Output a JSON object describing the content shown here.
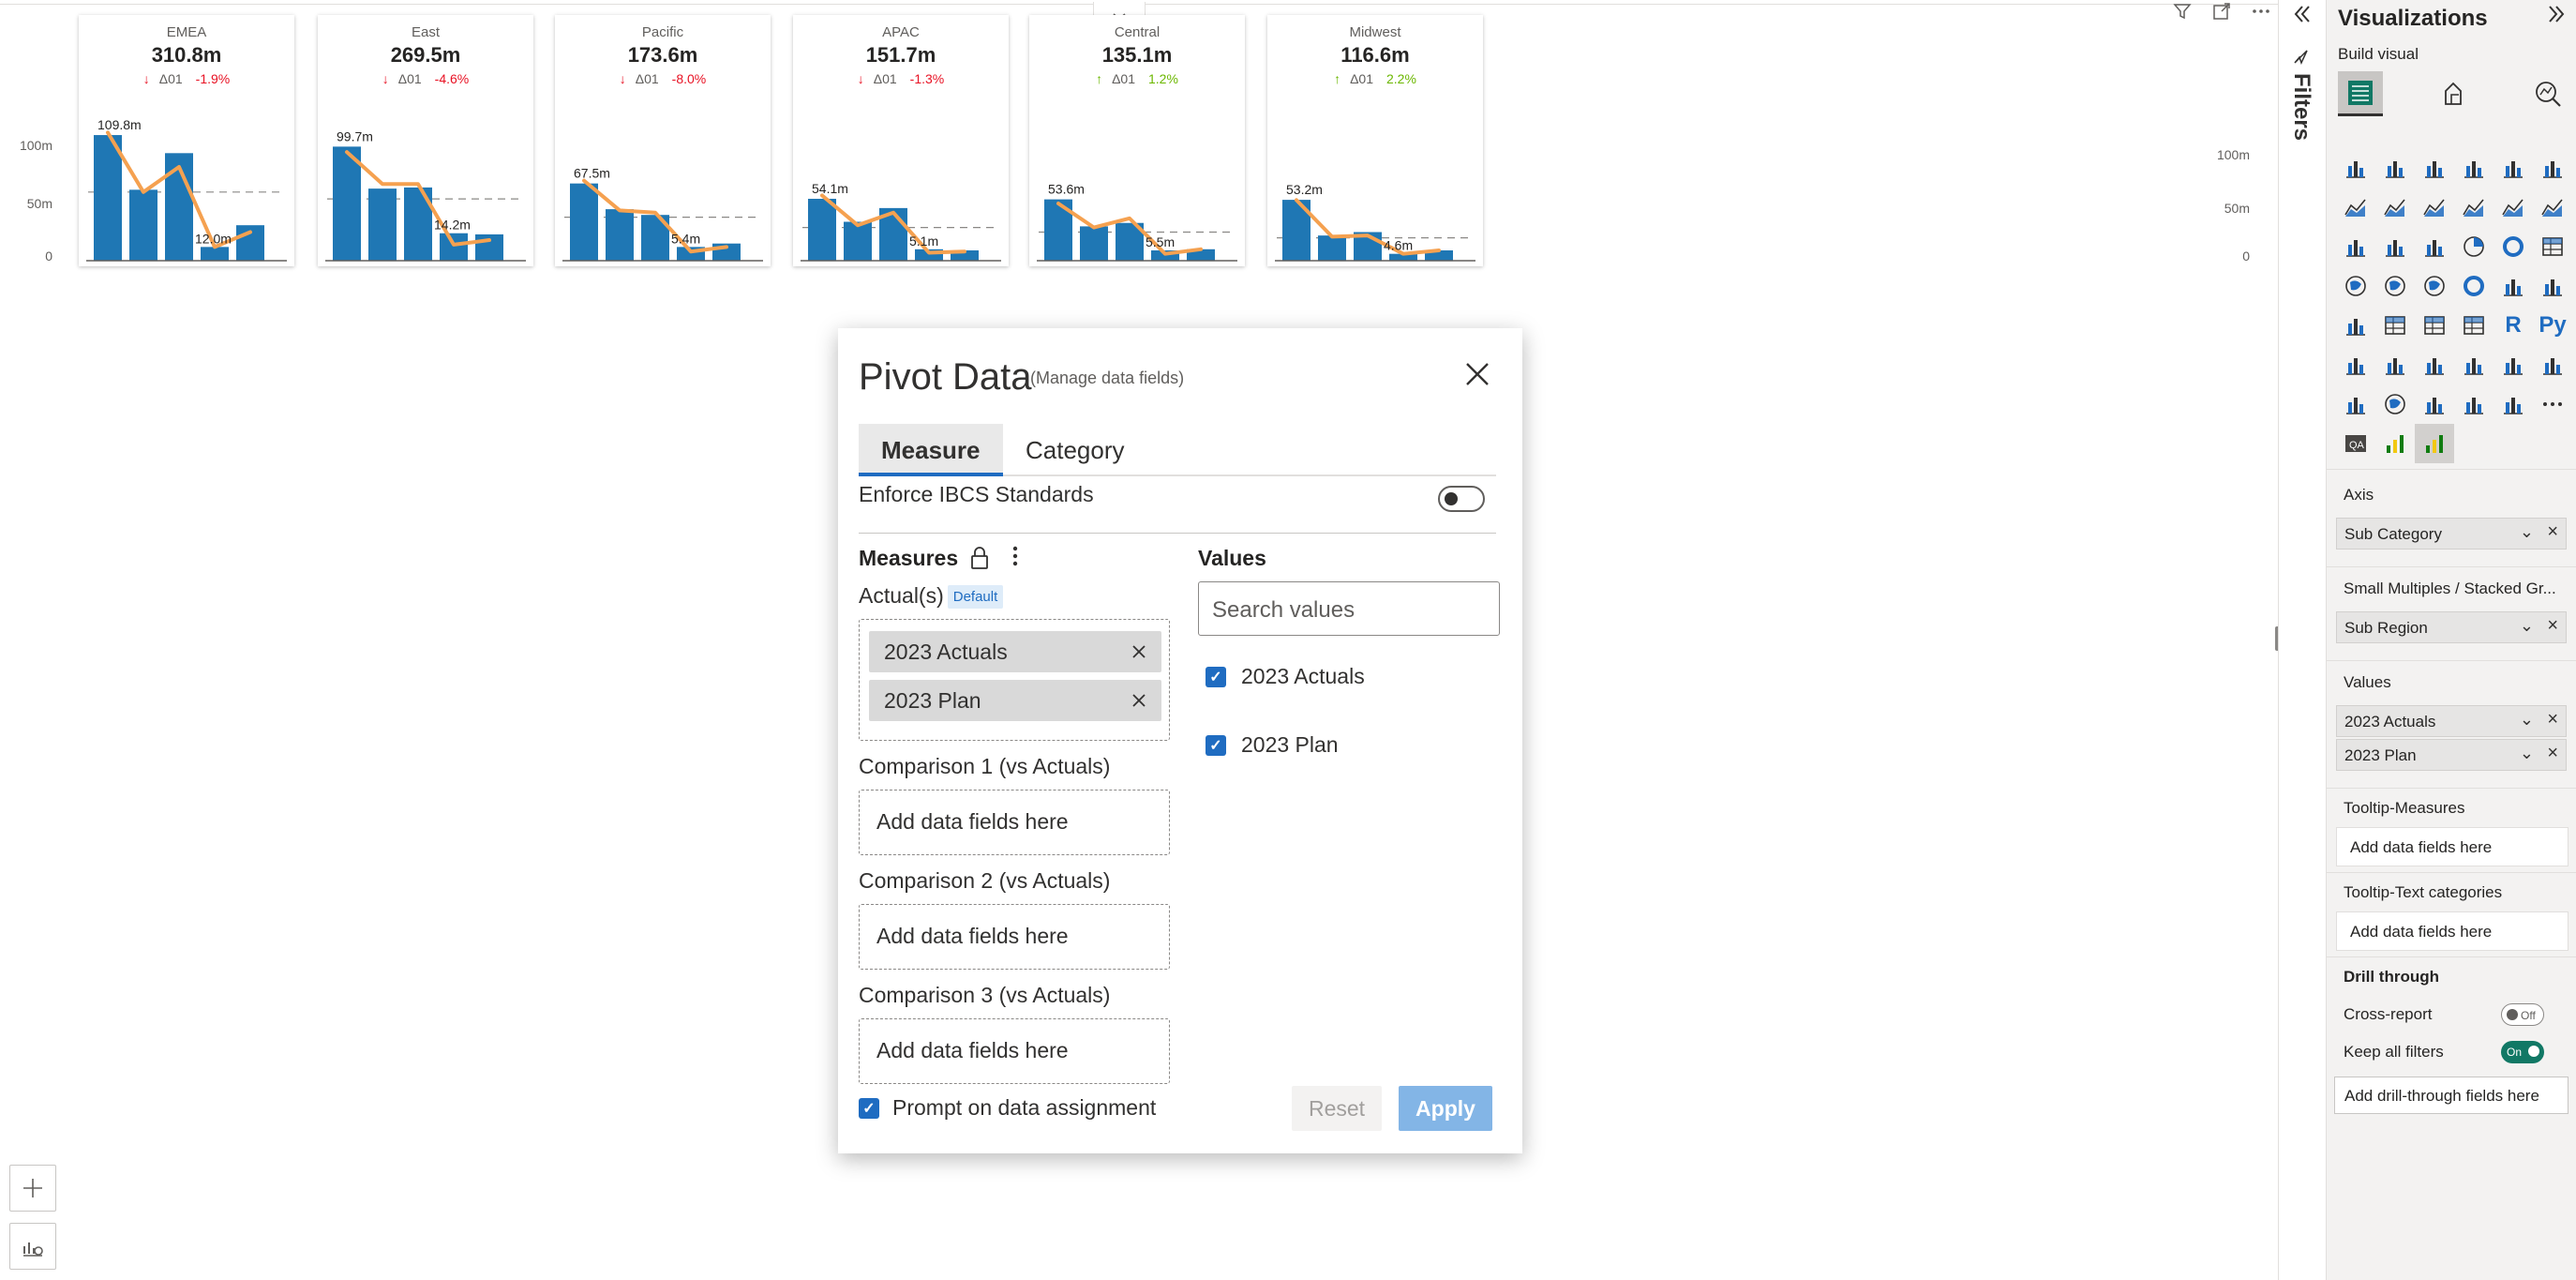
{
  "canvas": {
    "y_axis_left": [
      "100m",
      "50m",
      "0"
    ],
    "y_axis_right": [
      "100m",
      "50m",
      "0"
    ],
    "header_icons": [
      "filter-icon",
      "focus-mode-icon",
      "more-options-icon"
    ],
    "collapse_icon": "double-chevron-down-icon"
  },
  "cards": [
    {
      "region": "EMEA",
      "total": "310.8m",
      "direction": "down",
      "delta_label": "Δ01",
      "pct": "-1.9%",
      "bars": [
        109.8,
        62,
        94,
        12,
        31
      ],
      "line": [
        112,
        60,
        82,
        12,
        25
      ],
      "plan_ref": 60,
      "labels": [
        "109.8m",
        "12.0m"
      ]
    },
    {
      "region": "East",
      "total": "269.5m",
      "direction": "down",
      "delta_label": "Δ01",
      "pct": "-4.6%",
      "bars": [
        99.7,
        63,
        64,
        24,
        23
      ],
      "line": [
        95,
        67,
        67,
        14,
        18
      ],
      "plan_ref": 54,
      "labels": [
        "99.7m",
        "14.2m"
      ]
    },
    {
      "region": "Pacific",
      "total": "173.6m",
      "direction": "down",
      "delta_label": "Δ01",
      "pct": "-8.0%",
      "bars": [
        67.5,
        45,
        40,
        12,
        15
      ],
      "line": [
        70,
        44,
        42,
        8,
        12
      ],
      "plan_ref": 38,
      "labels": [
        "67.5m",
        "5.4m"
      ]
    },
    {
      "region": "APAC",
      "total": "151.7m",
      "direction": "down",
      "delta_label": "Δ01",
      "pct": "-1.3%",
      "bars": [
        54.1,
        34,
        46,
        10,
        9
      ],
      "line": [
        57,
        31,
        42,
        7,
        8
      ],
      "plan_ref": 29,
      "labels": [
        "54.1m",
        "5.1m"
      ]
    },
    {
      "region": "Central",
      "total": "135.1m",
      "direction": "up",
      "delta_label": "Δ01",
      "pct": "1.2%",
      "bars": [
        53.6,
        30,
        33,
        9,
        10
      ],
      "line": [
        50,
        29,
        37,
        6,
        10
      ],
      "plan_ref": 25,
      "labels": [
        "53.6m",
        "5.5m"
      ]
    },
    {
      "region": "Midwest",
      "total": "116.6m",
      "direction": "up",
      "delta_label": "Δ01",
      "pct": "2.2%",
      "bars": [
        53.2,
        22,
        25,
        6,
        9
      ],
      "line": [
        53,
        21,
        22,
        6,
        9
      ],
      "plan_ref": 20,
      "labels": [
        "53.2m",
        "4.6m"
      ]
    }
  ],
  "dialog": {
    "title": "Pivot Data",
    "subtitle": "(Manage data fields)",
    "close_icon": "close-icon",
    "tabs": [
      "Measure",
      "Category"
    ],
    "active_tab": "Measure",
    "ibcs_label": "Enforce IBCS Standards",
    "ibcs_enabled": false,
    "measures_title": "Measures",
    "actuals_label": "Actual(s)",
    "default_badge": "Default",
    "actual_chips": [
      "2023 Actuals",
      "2023 Plan"
    ],
    "comparisons": [
      {
        "label": "Comparison 1 (vs Actuals)",
        "placeholder": "Add data fields here"
      },
      {
        "label": "Comparison 2 (vs Actuals)",
        "placeholder": "Add data fields here"
      },
      {
        "label": "Comparison 3 (vs Actuals)",
        "placeholder": "Add data fields here"
      }
    ],
    "values_title": "Values",
    "search_placeholder": "Search values",
    "values": [
      {
        "label": "2023 Actuals",
        "checked": true
      },
      {
        "label": "2023 Plan",
        "checked": true
      }
    ],
    "prompt_label": "Prompt on data assignment",
    "prompt_checked": true,
    "reset_label": "Reset",
    "apply_label": "Apply"
  },
  "filters": {
    "label": "Filters"
  },
  "viz": {
    "title": "Visualizations",
    "build_label": "Build visual",
    "axis_label": "Axis",
    "axis_field": "Sub Category",
    "small_multiples_label": "Small Multiples / Stacked Gr...",
    "small_multiples_field": "Sub Region",
    "values_label": "Values",
    "values_fields": [
      "2023 Actuals",
      "2023 Plan"
    ],
    "tooltip_measures_label": "Tooltip-Measures",
    "tooltip_measures_placeholder": "Add data fields here",
    "tooltip_text_label": "Tooltip-Text categories",
    "tooltip_text_placeholder": "Add data fields here",
    "drill_label": "Drill through",
    "cross_report_label": "Cross-report",
    "cross_report_state": "Off",
    "keep_filters_label": "Keep all filters",
    "keep_filters_state": "On",
    "drill_button": "Add drill-through fields here",
    "gallery_text_icons": [
      "R",
      "Py"
    ]
  },
  "colors": {
    "bar": "#1f77b4",
    "line": "#f5a150",
    "down": "#e81123",
    "up": "#6bb700",
    "accent": "#1f6cc1",
    "toggle_on": "#117865"
  }
}
